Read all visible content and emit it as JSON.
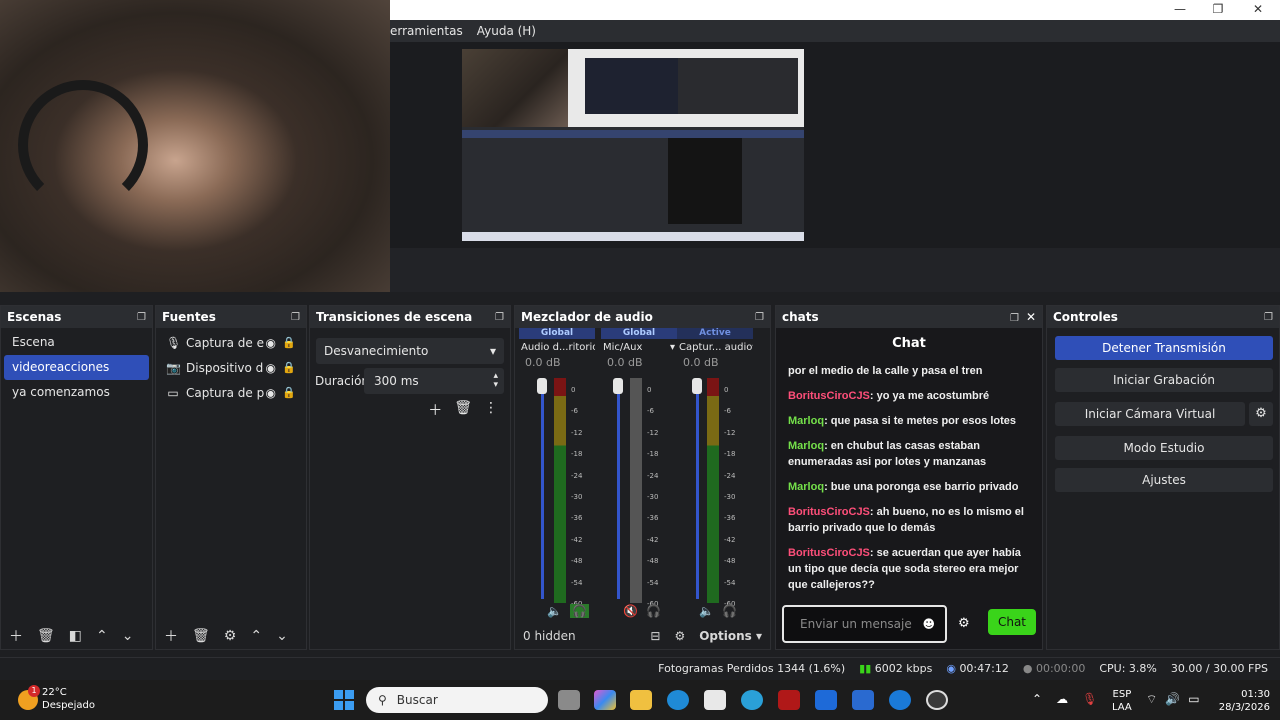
{
  "menubar": {
    "items": [
      "erramientas",
      "Ayuda (H)"
    ]
  },
  "window_controls": {
    "minimize": "—",
    "maximize": "❐",
    "close": "✕"
  },
  "scenes": {
    "title": "Escenas",
    "items": [
      "Escena",
      "videoreacciones",
      "ya comenzamos"
    ],
    "selected_index": 1
  },
  "sources": {
    "title": "Fuentes",
    "items": [
      {
        "label": "Captura de ent",
        "icon": "microphone-icon"
      },
      {
        "label": "Dispositivo de",
        "icon": "camera-icon"
      },
      {
        "label": "Captura de par",
        "icon": "monitor-icon"
      }
    ]
  },
  "transitions": {
    "title": "Transiciones de escena",
    "selected": "Desvanecimiento",
    "duration_label": "Duración",
    "duration_value": "300 ms"
  },
  "mixer": {
    "title": "Mezclador de audio",
    "channels": [
      {
        "scope": "Global",
        "name": "Audio d...ritorio",
        "db": "0.0 dB",
        "level": 0.0
      },
      {
        "scope": "Global",
        "name": "Mic/Aux",
        "db": "0.0 dB",
        "level": 0.0
      },
      {
        "scope": "Active",
        "name": "Captur... audio",
        "db": "0.0 dB",
        "level": 0.0
      }
    ],
    "scale": [
      "0",
      "-6",
      "-12",
      "-18",
      "-24",
      "-30",
      "-36",
      "-42",
      "-48",
      "-54",
      "-60"
    ],
    "hidden_label": "0 hidden",
    "options_label": "Options"
  },
  "chats": {
    "dock_title": "chats",
    "title": "Chat",
    "messages": [
      {
        "user": "",
        "text": "por el medio de la calle y pasa el tren",
        "color": ""
      },
      {
        "user": "BoritusCiroCJS",
        "text": "yo ya me acostumbré",
        "color": "u1"
      },
      {
        "user": "Marloq",
        "text": "que pasa si te metes por esos lotes",
        "color": "u2"
      },
      {
        "user": "Marloq",
        "text": "en chubut las casas estaban enumeradas asi por lotes y manzanas",
        "color": "u2"
      },
      {
        "user": "Marloq",
        "text": "bue una poronga ese barrio privado",
        "color": "u2"
      },
      {
        "user": "BoritusCiroCJS",
        "text": "ah bueno, no es lo mismo el barrio privado que lo demás",
        "color": "u1"
      },
      {
        "user": "BoritusCiroCJS",
        "text": "se acuerdan que ayer había un tipo que decía que soda stereo era mejor que callejeros??",
        "color": "u1"
      }
    ],
    "input_placeholder": "Enviar un mensaje",
    "send_label": "Chat"
  },
  "controls": {
    "title": "Controles",
    "buttons": [
      "Detener Transmisión",
      "Iniciar Grabación",
      "Iniciar Cámara Virtual",
      "Modo Estudio",
      "Ajustes"
    ]
  },
  "statusbar": {
    "dropped": "Fotogramas Perdidos 1344 (1.6%)",
    "bitrate": "6002 kbps",
    "stream_time": "00:47:12",
    "rec_time": "00:00:00",
    "cpu": "CPU: 3.8%",
    "fps": "30.00 / 30.00 FPS"
  },
  "taskbar": {
    "weather_temp": "22°C",
    "weather_desc": "Despejado",
    "weather_badge": "1",
    "search_placeholder": "Buscar",
    "lang_top": "ESP",
    "lang_bottom": "LAA",
    "time": "01:30",
    "date": "28/3/2026"
  },
  "colors": {
    "accent": "#2f4fb8",
    "chat_green": "#3ad41a",
    "user_red": "#ff4f7a",
    "user_green": "#74e04a"
  }
}
